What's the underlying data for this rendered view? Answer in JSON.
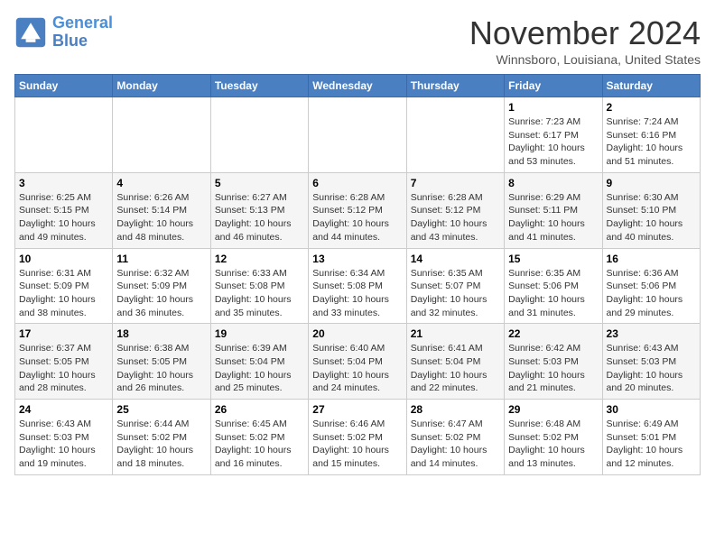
{
  "logo": {
    "text_general": "General",
    "text_blue": "Blue"
  },
  "header": {
    "month": "November 2024",
    "location": "Winnsboro, Louisiana, United States"
  },
  "weekdays": [
    "Sunday",
    "Monday",
    "Tuesday",
    "Wednesday",
    "Thursday",
    "Friday",
    "Saturday"
  ],
  "weeks": [
    [
      {
        "day": "",
        "info": ""
      },
      {
        "day": "",
        "info": ""
      },
      {
        "day": "",
        "info": ""
      },
      {
        "day": "",
        "info": ""
      },
      {
        "day": "",
        "info": ""
      },
      {
        "day": "1",
        "info": "Sunrise: 7:23 AM\nSunset: 6:17 PM\nDaylight: 10 hours\nand 53 minutes."
      },
      {
        "day": "2",
        "info": "Sunrise: 7:24 AM\nSunset: 6:16 PM\nDaylight: 10 hours\nand 51 minutes."
      }
    ],
    [
      {
        "day": "3",
        "info": "Sunrise: 6:25 AM\nSunset: 5:15 PM\nDaylight: 10 hours\nand 49 minutes."
      },
      {
        "day": "4",
        "info": "Sunrise: 6:26 AM\nSunset: 5:14 PM\nDaylight: 10 hours\nand 48 minutes."
      },
      {
        "day": "5",
        "info": "Sunrise: 6:27 AM\nSunset: 5:13 PM\nDaylight: 10 hours\nand 46 minutes."
      },
      {
        "day": "6",
        "info": "Sunrise: 6:28 AM\nSunset: 5:12 PM\nDaylight: 10 hours\nand 44 minutes."
      },
      {
        "day": "7",
        "info": "Sunrise: 6:28 AM\nSunset: 5:12 PM\nDaylight: 10 hours\nand 43 minutes."
      },
      {
        "day": "8",
        "info": "Sunrise: 6:29 AM\nSunset: 5:11 PM\nDaylight: 10 hours\nand 41 minutes."
      },
      {
        "day": "9",
        "info": "Sunrise: 6:30 AM\nSunset: 5:10 PM\nDaylight: 10 hours\nand 40 minutes."
      }
    ],
    [
      {
        "day": "10",
        "info": "Sunrise: 6:31 AM\nSunset: 5:09 PM\nDaylight: 10 hours\nand 38 minutes."
      },
      {
        "day": "11",
        "info": "Sunrise: 6:32 AM\nSunset: 5:09 PM\nDaylight: 10 hours\nand 36 minutes."
      },
      {
        "day": "12",
        "info": "Sunrise: 6:33 AM\nSunset: 5:08 PM\nDaylight: 10 hours\nand 35 minutes."
      },
      {
        "day": "13",
        "info": "Sunrise: 6:34 AM\nSunset: 5:08 PM\nDaylight: 10 hours\nand 33 minutes."
      },
      {
        "day": "14",
        "info": "Sunrise: 6:35 AM\nSunset: 5:07 PM\nDaylight: 10 hours\nand 32 minutes."
      },
      {
        "day": "15",
        "info": "Sunrise: 6:35 AM\nSunset: 5:06 PM\nDaylight: 10 hours\nand 31 minutes."
      },
      {
        "day": "16",
        "info": "Sunrise: 6:36 AM\nSunset: 5:06 PM\nDaylight: 10 hours\nand 29 minutes."
      }
    ],
    [
      {
        "day": "17",
        "info": "Sunrise: 6:37 AM\nSunset: 5:05 PM\nDaylight: 10 hours\nand 28 minutes."
      },
      {
        "day": "18",
        "info": "Sunrise: 6:38 AM\nSunset: 5:05 PM\nDaylight: 10 hours\nand 26 minutes."
      },
      {
        "day": "19",
        "info": "Sunrise: 6:39 AM\nSunset: 5:04 PM\nDaylight: 10 hours\nand 25 minutes."
      },
      {
        "day": "20",
        "info": "Sunrise: 6:40 AM\nSunset: 5:04 PM\nDaylight: 10 hours\nand 24 minutes."
      },
      {
        "day": "21",
        "info": "Sunrise: 6:41 AM\nSunset: 5:04 PM\nDaylight: 10 hours\nand 22 minutes."
      },
      {
        "day": "22",
        "info": "Sunrise: 6:42 AM\nSunset: 5:03 PM\nDaylight: 10 hours\nand 21 minutes."
      },
      {
        "day": "23",
        "info": "Sunrise: 6:43 AM\nSunset: 5:03 PM\nDaylight: 10 hours\nand 20 minutes."
      }
    ],
    [
      {
        "day": "24",
        "info": "Sunrise: 6:43 AM\nSunset: 5:03 PM\nDaylight: 10 hours\nand 19 minutes."
      },
      {
        "day": "25",
        "info": "Sunrise: 6:44 AM\nSunset: 5:02 PM\nDaylight: 10 hours\nand 18 minutes."
      },
      {
        "day": "26",
        "info": "Sunrise: 6:45 AM\nSunset: 5:02 PM\nDaylight: 10 hours\nand 16 minutes."
      },
      {
        "day": "27",
        "info": "Sunrise: 6:46 AM\nSunset: 5:02 PM\nDaylight: 10 hours\nand 15 minutes."
      },
      {
        "day": "28",
        "info": "Sunrise: 6:47 AM\nSunset: 5:02 PM\nDaylight: 10 hours\nand 14 minutes."
      },
      {
        "day": "29",
        "info": "Sunrise: 6:48 AM\nSunset: 5:02 PM\nDaylight: 10 hours\nand 13 minutes."
      },
      {
        "day": "30",
        "info": "Sunrise: 6:49 AM\nSunset: 5:01 PM\nDaylight: 10 hours\nand 12 minutes."
      }
    ]
  ]
}
